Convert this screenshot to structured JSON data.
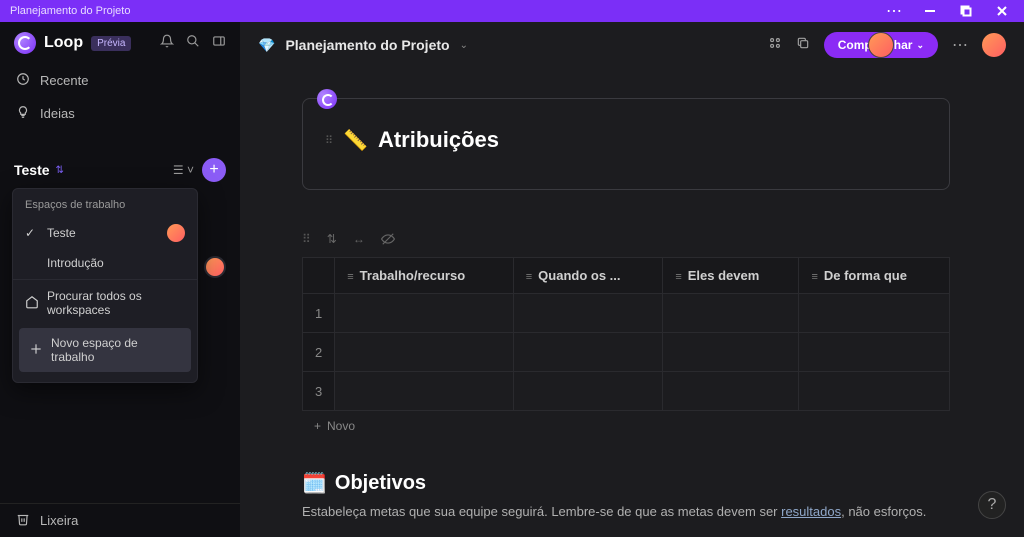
{
  "titlebar": {
    "title": "Planejamento do Projeto"
  },
  "sidebar": {
    "brand": "Loop",
    "badge": "Prévia",
    "nav": {
      "recent": "Recente",
      "ideas": "Ideias"
    },
    "workspace_name": "Teste",
    "trash": "Lixeira"
  },
  "dropdown": {
    "header": "Espaços de trabalho",
    "items": [
      {
        "label": "Teste",
        "selected": true,
        "avatar": true
      },
      {
        "label": "Introdução",
        "selected": false,
        "avatar": false
      }
    ],
    "browse_all": "Procurar todos os workspaces",
    "new_workspace": "Novo espaço de trabalho"
  },
  "toolbar": {
    "page_title": "Planejamento do Projeto",
    "share": "Compartilhar"
  },
  "card": {
    "emoji": "📏",
    "title": "Atribuições"
  },
  "table": {
    "columns": [
      "Trabalho/recurso",
      "Quando os ...",
      "Eles devem",
      "De forma que"
    ],
    "rows": [
      "1",
      "2",
      "3"
    ],
    "add_new": "Novo"
  },
  "objectives": {
    "emoji": "🗓️",
    "title": "Objetivos",
    "desc_pre": "Estabeleça metas que sua equipe seguirá. Lembre-se de que as metas devem ser ",
    "desc_link": "resultados",
    "desc_post": ", não esforços."
  },
  "help": "?"
}
